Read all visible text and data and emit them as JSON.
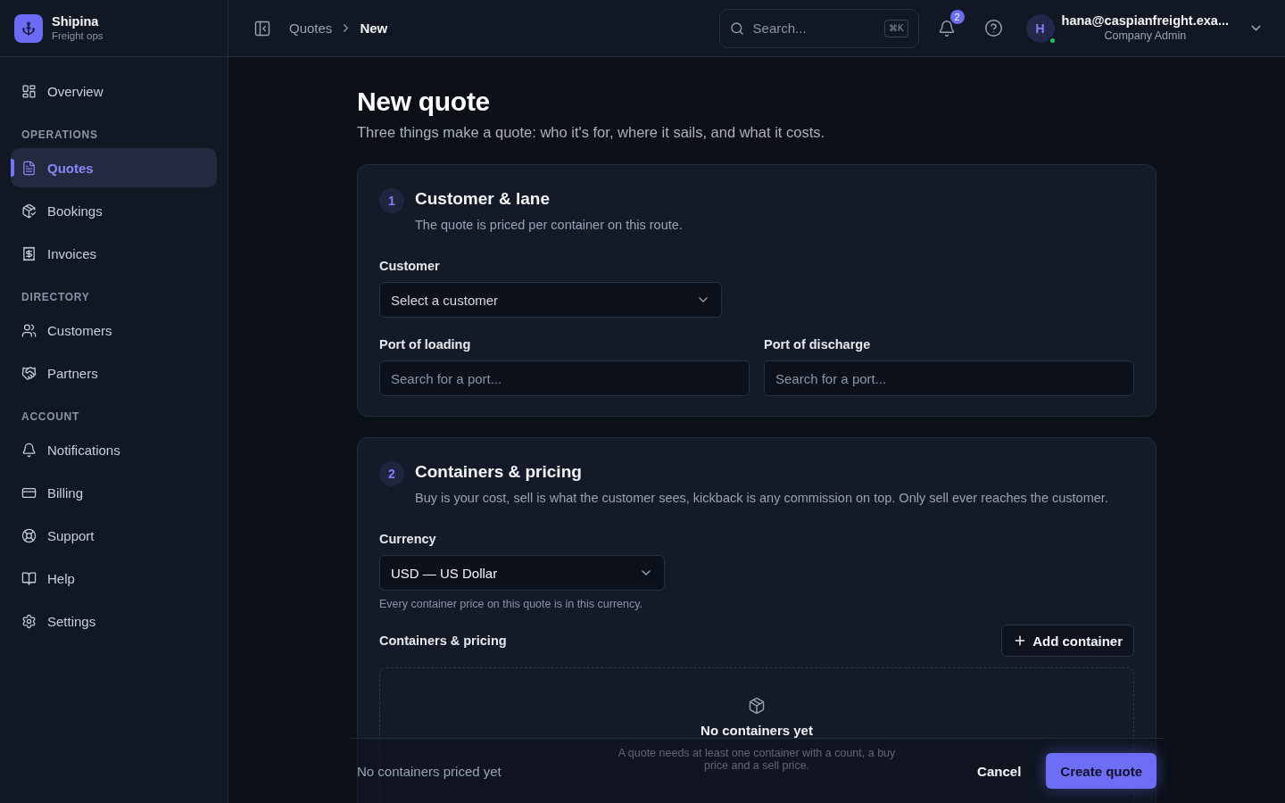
{
  "sidebar": {
    "brand": {
      "name": "Shipina",
      "tagline": "Freight ops"
    },
    "sections": [
      {
        "items": [
          {
            "label": "Overview",
            "selected": false
          }
        ]
      },
      {
        "heading": "OPERATIONS",
        "items": [
          {
            "label": "Quotes",
            "selected": true
          },
          {
            "label": "Bookings",
            "selected": false
          },
          {
            "label": "Invoices",
            "selected": false
          }
        ]
      },
      {
        "heading": "DIRECTORY",
        "items": [
          {
            "label": "Customers",
            "selected": false
          },
          {
            "label": "Partners",
            "selected": false
          }
        ]
      },
      {
        "heading": "ACCOUNT",
        "items": [
          {
            "label": "Notifications",
            "selected": false
          },
          {
            "label": "Billing",
            "selected": false
          },
          {
            "label": "Support",
            "selected": false
          },
          {
            "label": "Help",
            "selected": false
          },
          {
            "label": "Settings",
            "selected": false
          }
        ]
      }
    ]
  },
  "topbar": {
    "breadcrumb": [
      "Quotes",
      "New"
    ],
    "search": {
      "placeholder": "Search...",
      "shortcut": "⌘K"
    },
    "notification_count": "2",
    "user": {
      "initial": "H",
      "online": true,
      "email": "hana@caspianfreight.exa...",
      "role": "Company Admin"
    }
  },
  "page": {
    "title": "New quote",
    "subtitle": "Three things make a quote: who it's for, where it sails, and what it costs."
  },
  "steps": [
    {
      "number": "1",
      "title": "Customer & lane",
      "description": "The quote is priced per container on this route.",
      "rows": [
        [
          {
            "kind": "select",
            "label": "Customer",
            "placeholder": "Select a customer"
          }
        ],
        [
          {
            "kind": "search",
            "label": "Port of loading",
            "placeholder": "Search for a port..."
          },
          {
            "kind": "search",
            "label": "Port of discharge",
            "placeholder": "Search for a port..."
          }
        ]
      ]
    },
    {
      "number": "2",
      "title": "Containers & pricing",
      "description": "Buy is your cost, sell is what the customer sees, kickback is any commission on top. Only sell ever reaches the customer.",
      "rows": [
        [
          {
            "kind": "select",
            "label": "Currency",
            "value": "USD — US Dollar",
            "hint": "Every container price on this quote is in this currency."
          }
        ]
      ],
      "containers": {
        "label": "Containers & pricing",
        "add_button": "Add container",
        "empty_title": "No containers yet",
        "empty_description": "A quote needs at least one container with a count, a buy price and a sell price."
      }
    }
  ],
  "footer": {
    "status": "No containers priced yet",
    "cancel": "Cancel",
    "submit": "Create quote"
  }
}
